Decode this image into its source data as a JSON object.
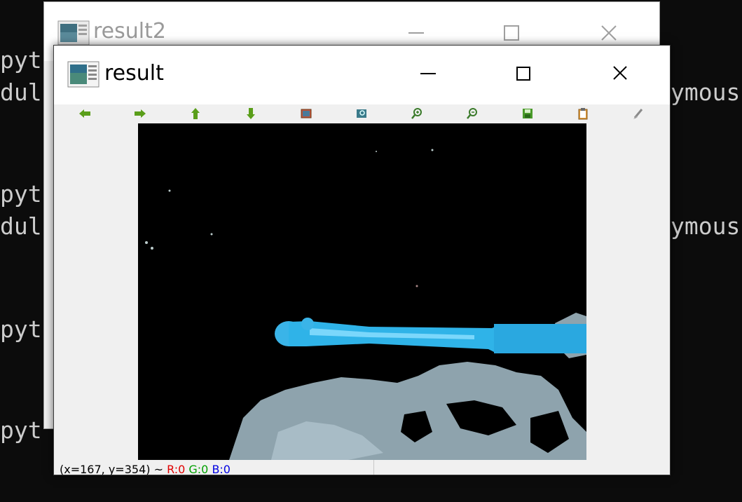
{
  "terminal": {
    "lines_left": [
      "pyt",
      "dul",
      "pyt",
      "dul",
      "pyt",
      "pyt"
    ],
    "lines_right": [
      "ymous",
      "ymous"
    ]
  },
  "window_back": {
    "title": "result2",
    "icon": "app-window-icon",
    "controls": [
      "minimize-icon",
      "maximize-icon",
      "close-icon"
    ]
  },
  "window_front": {
    "title": "result",
    "icon": "app-window-icon",
    "controls": [
      "minimize-icon",
      "maximize-icon",
      "close-icon"
    ],
    "toolbar": [
      {
        "name": "pan-left",
        "icon": "arrow-left-icon"
      },
      {
        "name": "pan-right",
        "icon": "arrow-right-icon"
      },
      {
        "name": "pan-up",
        "icon": "arrow-up-icon"
      },
      {
        "name": "pan-down",
        "icon": "arrow-down-icon"
      },
      {
        "name": "zoom-fit",
        "icon": "image-icon"
      },
      {
        "name": "zoom-1x",
        "icon": "zoom-region-icon"
      },
      {
        "name": "zoom-in",
        "icon": "zoom-in-icon"
      },
      {
        "name": "zoom-out",
        "icon": "zoom-out-icon"
      },
      {
        "name": "save",
        "icon": "save-icon"
      },
      {
        "name": "copy",
        "icon": "clipboard-icon"
      },
      {
        "name": "properties",
        "icon": "brush-icon"
      }
    ],
    "status": {
      "coords": "(x=167, y=354) ~",
      "r": "R:0",
      "g": "G:0",
      "b": "B:0"
    }
  },
  "colors": {
    "terminal_bg": "#0c0c0c",
    "terminal_text": "#cccccc",
    "toolbar_green": "#5a9e1a",
    "object_cyan": "#2fb3e8",
    "floor_gray": "#8ea3ad"
  }
}
